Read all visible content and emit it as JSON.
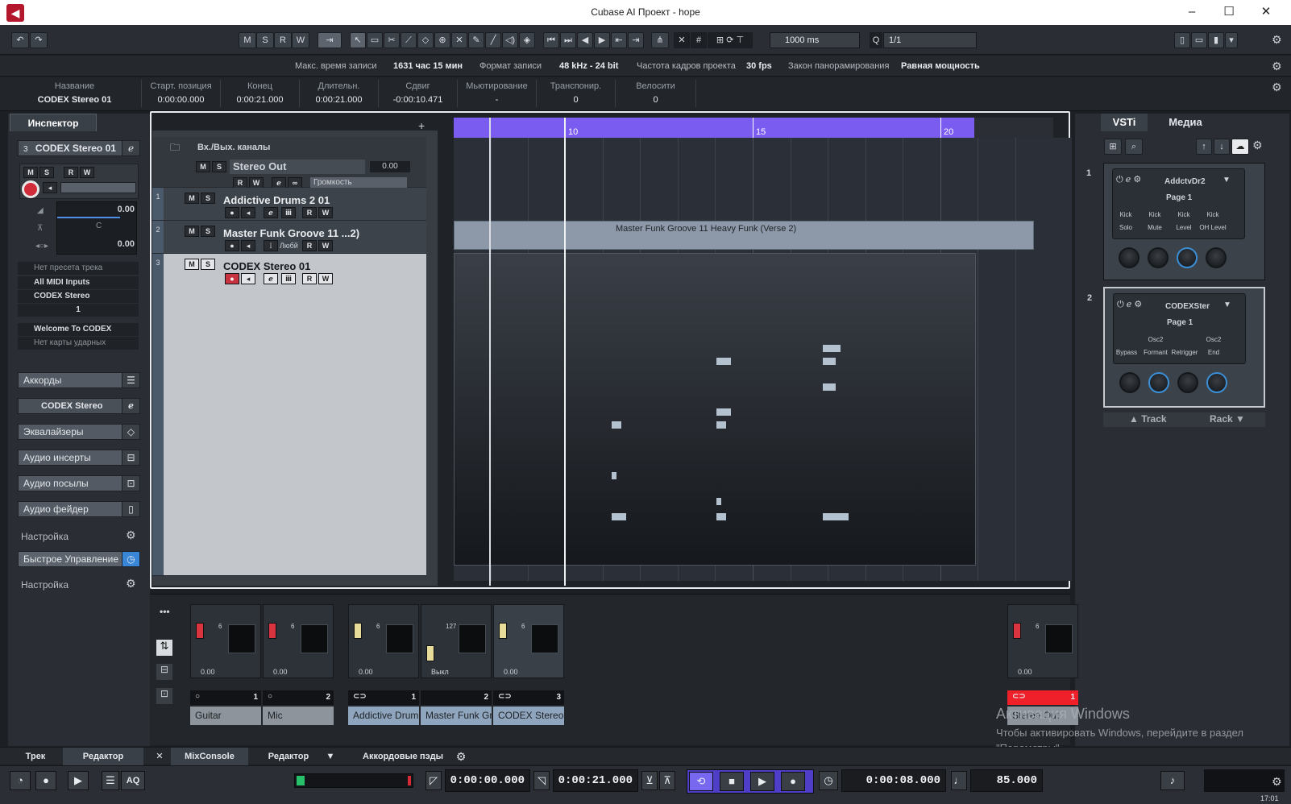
{
  "app": {
    "window_title": "Cubase AI Проект - hope",
    "minimize": "–",
    "maximize": "☐",
    "close": "✕"
  },
  "toolbar": {
    "undo": "↶",
    "redo": "↷",
    "mode_buttons": [
      "M",
      "S",
      "R",
      "W"
    ],
    "nudge_field": "1000 ms",
    "quantize_icon": "Q",
    "quantize_field": "1/1"
  },
  "info_line": {
    "rec_time_label": "Макс. время записи",
    "rec_time_value": "1631 час 15 мин",
    "rec_format_label": "Формат записи",
    "rec_format_value": "48 kHz - 24 bit",
    "frame_rate_label": "Частота кадров проекта",
    "frame_rate_value": "30 fps",
    "pan_law_label": "Закон панорамирования",
    "pan_law_value": "Равная мощность"
  },
  "track_info": {
    "name_label": "Название",
    "name_value": "CODEX Stereo 01",
    "start_label": "Старт. позиция",
    "start_value": "0:00:00.000",
    "end_label": "Конец",
    "end_value": "0:00:21.000",
    "length_label": "Длительн.",
    "length_value": "0:00:21.000",
    "offset_label": "Сдвиг",
    "offset_value": "-0:00:10.471",
    "mute_label": "Мьютирование",
    "mute_value": "-",
    "transpose_label": "Транспонир.",
    "transpose_value": "0",
    "velocity_label": "Велосити",
    "velocity_value": "0"
  },
  "inspector": {
    "tab": "Инспектор",
    "track_number": "3",
    "track_name": "CODEX Stereo 01",
    "volume_value": "0.00",
    "pan_value": "C",
    "delay_value": "0.00",
    "preset": "Нет пресета трека",
    "input": "All MIDI Inputs",
    "output": "CODEX Stereo",
    "channel": "1",
    "program": "Welcome To CODEX",
    "drum_map": "Нет карты ударных",
    "chords": "Аккорды",
    "instrument_name": "CODEX Stereo",
    "eq": "Эквалайзеры",
    "inserts": "Аудио инсерты",
    "sends": "Аудио посылы",
    "fader": "Аудио фейдер",
    "setup1": "Настройка",
    "quick_controls": "Быстрое Управление",
    "setup2": "Настройка"
  },
  "tracklist": {
    "io_folder": "Вх./Вых. каналы",
    "stereo_out": "Stereo Out",
    "stereo_out_value": "0.00",
    "volume_label": "Громкость",
    "add": "+",
    "tracks": [
      {
        "num": "1",
        "name": "Addictive Drums 2 01"
      },
      {
        "num": "2",
        "name": "Master Funk Groove 11 ...2)",
        "extra": "Любй"
      },
      {
        "num": "3",
        "name": "CODEX Stereo 01"
      }
    ]
  },
  "ruler": {
    "marks": [
      "10",
      "15",
      "20"
    ]
  },
  "events": {
    "midi_part_label": "Master Funk Groove 11 Heavy Funk (Verse 2)"
  },
  "vsti": {
    "tab_vsti": "VSTi",
    "tab_media": "Медиа",
    "slots": [
      {
        "num": "1",
        "name": "AddctvDr2",
        "page": "Page 1",
        "params_top": [
          "Kick",
          "Kick",
          "Kick",
          "Kick"
        ],
        "params_bottom": [
          "Solo",
          "Mute",
          "Level",
          "OH Level"
        ]
      },
      {
        "num": "2",
        "name": "CODEXSter",
        "page": "Page 1",
        "params_top": [
          "",
          "Osc2",
          "",
          "Osc2"
        ],
        "params_bottom": [
          "Bypass",
          "Formant",
          "Retrigger",
          "End"
        ]
      }
    ],
    "track_label": "Track",
    "rack_label": "Rack"
  },
  "mixer": {
    "channels": [
      {
        "num": "1",
        "name": "Guitar",
        "val": "0.00",
        "scale": "6"
      },
      {
        "num": "2",
        "name": "Mic",
        "val": "0.00",
        "scale": "6"
      },
      {
        "num": "1",
        "name": "Addictive Drum",
        "val": "0.00",
        "scale": "6"
      },
      {
        "num": "2",
        "name": "Master Funk Gr",
        "val": "Выкл",
        "scale": "127"
      },
      {
        "num": "3",
        "name": "CODEX Stereo (",
        "val": "0.00",
        "scale": "6"
      },
      {
        "num": "1",
        "name": "Stereo Out",
        "val": "0.00",
        "scale": "6"
      }
    ]
  },
  "bottom_tabs": {
    "track": "Трек",
    "editor_left": "Редактор",
    "mixconsole": "MixConsole",
    "editor": "Редактор",
    "chord_pads": "Аккордовые пэды"
  },
  "transport": {
    "left_locator": "0:00:00.000",
    "right_locator": "0:00:21.000",
    "position": "0:00:08.000",
    "tempo": "85.000",
    "aq": "AQ",
    "clock": "17:01"
  },
  "watermark": {
    "line1": "Активация Windows",
    "line2": "Чтобы активировать Windows, перейдите в раздел",
    "line3": "\"Параметры\"."
  }
}
